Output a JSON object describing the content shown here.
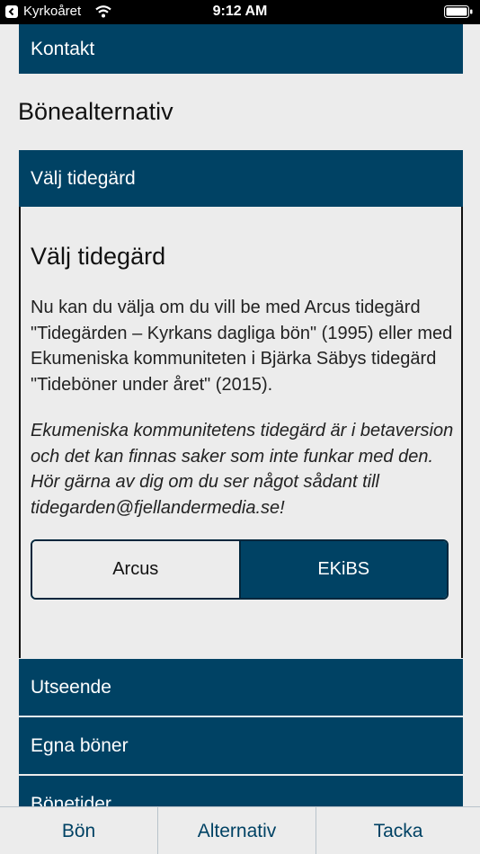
{
  "status_bar": {
    "back_app": "Kyrkoåret",
    "time": "9:12 AM"
  },
  "nav_rows": {
    "contact": "Kontakt",
    "choose_office": "Välj tidegärd",
    "appearance": "Utseende",
    "own_prayers": "Egna böner",
    "prayer_times": "Bönetider"
  },
  "section": {
    "heading": "Bönealternativ"
  },
  "panel": {
    "title": "Välj tidegärd",
    "body": "Nu kan du välja om du vill be med Arcus tidegärd \"Tidegärden – Kyrkans dagliga bön\" (1995) eller med Ekumeniska kommuniteten i Bjärka Säbys tidegärd \"Tideböner under året\" (2015).",
    "note": "Ekumeniska kommunitetens tidegärd är i betaversion och det kan finnas saker som inte funkar med den. Hör gärna av dig om du ser något sådant till tidegarden@fjellandermedia.se!",
    "options": {
      "arcus": "Arcus",
      "ekibs": "EKiBS",
      "selected": "EKiBS"
    }
  },
  "tabs": {
    "pray": "Bön",
    "options": "Alternativ",
    "thanks": "Tacka"
  },
  "colors": {
    "accent": "#004264",
    "background": "#ececec"
  }
}
